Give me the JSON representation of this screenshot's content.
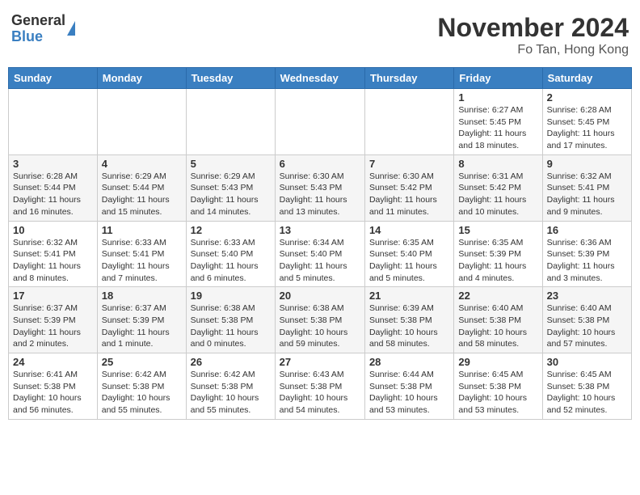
{
  "header": {
    "logo_general": "General",
    "logo_blue": "Blue",
    "month_title": "November 2024",
    "subtitle": "Fo Tan, Hong Kong"
  },
  "calendar": {
    "days_of_week": [
      "Sunday",
      "Monday",
      "Tuesday",
      "Wednesday",
      "Thursday",
      "Friday",
      "Saturday"
    ],
    "weeks": [
      [
        {
          "day": "",
          "info": ""
        },
        {
          "day": "",
          "info": ""
        },
        {
          "day": "",
          "info": ""
        },
        {
          "day": "",
          "info": ""
        },
        {
          "day": "",
          "info": ""
        },
        {
          "day": "1",
          "info": "Sunrise: 6:27 AM\nSunset: 5:45 PM\nDaylight: 11 hours and 18 minutes."
        },
        {
          "day": "2",
          "info": "Sunrise: 6:28 AM\nSunset: 5:45 PM\nDaylight: 11 hours and 17 minutes."
        }
      ],
      [
        {
          "day": "3",
          "info": "Sunrise: 6:28 AM\nSunset: 5:44 PM\nDaylight: 11 hours and 16 minutes."
        },
        {
          "day": "4",
          "info": "Sunrise: 6:29 AM\nSunset: 5:44 PM\nDaylight: 11 hours and 15 minutes."
        },
        {
          "day": "5",
          "info": "Sunrise: 6:29 AM\nSunset: 5:43 PM\nDaylight: 11 hours and 14 minutes."
        },
        {
          "day": "6",
          "info": "Sunrise: 6:30 AM\nSunset: 5:43 PM\nDaylight: 11 hours and 13 minutes."
        },
        {
          "day": "7",
          "info": "Sunrise: 6:30 AM\nSunset: 5:42 PM\nDaylight: 11 hours and 11 minutes."
        },
        {
          "day": "8",
          "info": "Sunrise: 6:31 AM\nSunset: 5:42 PM\nDaylight: 11 hours and 10 minutes."
        },
        {
          "day": "9",
          "info": "Sunrise: 6:32 AM\nSunset: 5:41 PM\nDaylight: 11 hours and 9 minutes."
        }
      ],
      [
        {
          "day": "10",
          "info": "Sunrise: 6:32 AM\nSunset: 5:41 PM\nDaylight: 11 hours and 8 minutes."
        },
        {
          "day": "11",
          "info": "Sunrise: 6:33 AM\nSunset: 5:41 PM\nDaylight: 11 hours and 7 minutes."
        },
        {
          "day": "12",
          "info": "Sunrise: 6:33 AM\nSunset: 5:40 PM\nDaylight: 11 hours and 6 minutes."
        },
        {
          "day": "13",
          "info": "Sunrise: 6:34 AM\nSunset: 5:40 PM\nDaylight: 11 hours and 5 minutes."
        },
        {
          "day": "14",
          "info": "Sunrise: 6:35 AM\nSunset: 5:40 PM\nDaylight: 11 hours and 5 minutes."
        },
        {
          "day": "15",
          "info": "Sunrise: 6:35 AM\nSunset: 5:39 PM\nDaylight: 11 hours and 4 minutes."
        },
        {
          "day": "16",
          "info": "Sunrise: 6:36 AM\nSunset: 5:39 PM\nDaylight: 11 hours and 3 minutes."
        }
      ],
      [
        {
          "day": "17",
          "info": "Sunrise: 6:37 AM\nSunset: 5:39 PM\nDaylight: 11 hours and 2 minutes."
        },
        {
          "day": "18",
          "info": "Sunrise: 6:37 AM\nSunset: 5:39 PM\nDaylight: 11 hours and 1 minute."
        },
        {
          "day": "19",
          "info": "Sunrise: 6:38 AM\nSunset: 5:38 PM\nDaylight: 11 hours and 0 minutes."
        },
        {
          "day": "20",
          "info": "Sunrise: 6:38 AM\nSunset: 5:38 PM\nDaylight: 10 hours and 59 minutes."
        },
        {
          "day": "21",
          "info": "Sunrise: 6:39 AM\nSunset: 5:38 PM\nDaylight: 10 hours and 58 minutes."
        },
        {
          "day": "22",
          "info": "Sunrise: 6:40 AM\nSunset: 5:38 PM\nDaylight: 10 hours and 58 minutes."
        },
        {
          "day": "23",
          "info": "Sunrise: 6:40 AM\nSunset: 5:38 PM\nDaylight: 10 hours and 57 minutes."
        }
      ],
      [
        {
          "day": "24",
          "info": "Sunrise: 6:41 AM\nSunset: 5:38 PM\nDaylight: 10 hours and 56 minutes."
        },
        {
          "day": "25",
          "info": "Sunrise: 6:42 AM\nSunset: 5:38 PM\nDaylight: 10 hours and 55 minutes."
        },
        {
          "day": "26",
          "info": "Sunrise: 6:42 AM\nSunset: 5:38 PM\nDaylight: 10 hours and 55 minutes."
        },
        {
          "day": "27",
          "info": "Sunrise: 6:43 AM\nSunset: 5:38 PM\nDaylight: 10 hours and 54 minutes."
        },
        {
          "day": "28",
          "info": "Sunrise: 6:44 AM\nSunset: 5:38 PM\nDaylight: 10 hours and 53 minutes."
        },
        {
          "day": "29",
          "info": "Sunrise: 6:45 AM\nSunset: 5:38 PM\nDaylight: 10 hours and 53 minutes."
        },
        {
          "day": "30",
          "info": "Sunrise: 6:45 AM\nSunset: 5:38 PM\nDaylight: 10 hours and 52 minutes."
        }
      ]
    ]
  }
}
